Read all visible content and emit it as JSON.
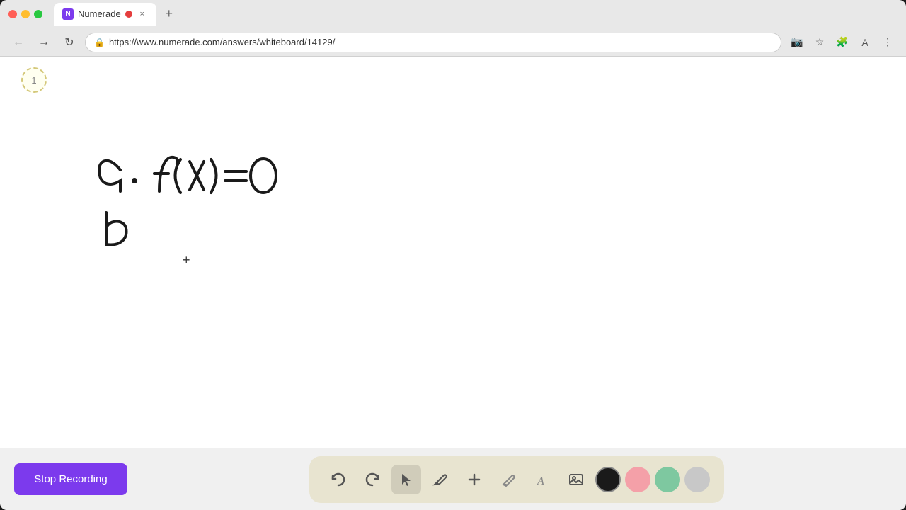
{
  "browser": {
    "tab_label": "Numerade",
    "tab_recording_indicator": true,
    "url": "https://www.numerade.com/answers/whiteboard/14129/",
    "page_number": "1"
  },
  "toolbar": {
    "stop_recording_label": "Stop Recording",
    "tools": [
      {
        "name": "undo",
        "icon": "↺",
        "label": "Undo"
      },
      {
        "name": "redo",
        "icon": "↻",
        "label": "Redo"
      },
      {
        "name": "select",
        "icon": "▲",
        "label": "Select"
      },
      {
        "name": "pen",
        "icon": "✏",
        "label": "Pen"
      },
      {
        "name": "add",
        "icon": "+",
        "label": "Add"
      },
      {
        "name": "eraser",
        "icon": "/",
        "label": "Eraser"
      },
      {
        "name": "text",
        "icon": "A",
        "label": "Text"
      },
      {
        "name": "image",
        "icon": "🖼",
        "label": "Image"
      }
    ],
    "colors": [
      {
        "name": "black",
        "hex": "#1a1a1a",
        "selected": true
      },
      {
        "name": "pink",
        "hex": "#f4a0a8",
        "selected": false
      },
      {
        "name": "green",
        "hex": "#7ec8a0",
        "selected": false
      },
      {
        "name": "gray",
        "hex": "#c8c8c8",
        "selected": false
      }
    ]
  }
}
